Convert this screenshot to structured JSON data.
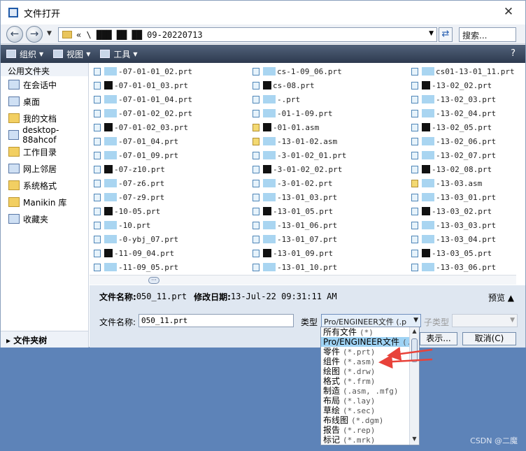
{
  "window": {
    "title": "文件打开",
    "close_glyph": "✕"
  },
  "address": {
    "path": "« \\ ███ ██ ██ 09-20220713",
    "search_placeholder": "搜索..."
  },
  "toolbar": {
    "organize": "组织",
    "view": "视图",
    "tools": "工具",
    "help_glyph": "?"
  },
  "sidebar": {
    "header": "公用文件夹",
    "items": [
      {
        "label": "在会话中",
        "icon": "session-icon"
      },
      {
        "label": "桌面",
        "icon": "desktop-icon"
      },
      {
        "label": "我的文档",
        "icon": "documents-icon"
      },
      {
        "label": "desktop-88ahcof",
        "icon": "computer-icon"
      },
      {
        "label": "工作目录",
        "icon": "work-folder-icon"
      },
      {
        "label": "网上邻居",
        "icon": "network-icon"
      },
      {
        "label": "系统格式",
        "icon": "system-format-icon"
      },
      {
        "label": "Manikin 库",
        "icon": "manikin-icon"
      },
      {
        "label": "收藏夹",
        "icon": "favorites-icon"
      }
    ],
    "folder_tree": "文件夹树"
  },
  "files": {
    "col1": [
      "-07-01-01_02.prt",
      "-07-01-01_03.prt",
      "-07-01-01_04.prt",
      "-07-01-02_02.prt",
      "-07-01-02_03.prt",
      "-07-01_04.prt",
      "-07-01_09.prt",
      "-07-z10.prt",
      "-07-z6.prt",
      "-07-z9.prt",
      "-10-05.prt",
      "-10.prt",
      "-0-ybj_07.prt",
      "-11-09_04.prt",
      "-11-09_05.prt"
    ],
    "col2": [
      "cs-1-09_06.prt",
      "cs-08.prt",
      "-.prt",
      "-01-1-09.prt",
      "-01-01.asm",
      "-13-01-02.asm",
      "-3-01-02_01.prt",
      "-3-01-02_02.prt",
      "-3-01-02.prt",
      "-13-01_03.prt",
      "-13-01_05.prt",
      "-13-01_06.prt",
      "-13-01_07.prt",
      "-13-01_09.prt",
      "-13-01_10.prt"
    ],
    "col3": [
      "cs01-13-01_11.prt",
      "-13-02_02.prt",
      "-13-02_03.prt",
      "-13-02_04.prt",
      "-13-02_05.prt",
      "-13-02_06.prt",
      "-13-02_07.prt",
      "-13-02_08.prt",
      "-13-03.asm",
      "-13-03_01.prt",
      "-13-03_02.prt",
      "-13-03_03.prt",
      "-13-03_04.prt",
      "-13-03_05.prt",
      "-13-03_06.prt"
    ]
  },
  "details": {
    "name_label": "文件名称:",
    "name_value": "050_11.prt",
    "date_label": "修改日期:",
    "date_value": "13-Jul-22 09:31:11 AM",
    "preview": "预览 ▲"
  },
  "form": {
    "filename_label": "文件名称:",
    "filename_value": "050_11.prt",
    "type_label": "类型",
    "type_value": "Pro/ENGINEER文件 (.p",
    "subtype_label": "子类型",
    "open_button": "表示...",
    "cancel_button": "取消(C)"
  },
  "dropdown": {
    "options": [
      {
        "name": "所有文件",
        "pattern": "(*)"
      },
      {
        "name": "Pro/ENGINEER文件",
        "pattern": "(.p"
      },
      {
        "name": "零件",
        "pattern": "(*.prt)"
      },
      {
        "name": "组件",
        "pattern": "(*.asm)"
      },
      {
        "name": "绘图",
        "pattern": "(*.drw)"
      },
      {
        "name": "格式",
        "pattern": "(*.frm)"
      },
      {
        "name": "制造",
        "pattern": "(.asm, .mfg)"
      },
      {
        "name": "布局",
        "pattern": "(*.lay)"
      },
      {
        "name": "草绘",
        "pattern": "(*.sec)"
      },
      {
        "name": "布线图",
        "pattern": "(*.dgm)"
      },
      {
        "name": "报告",
        "pattern": "(*.rep)"
      },
      {
        "name": "标记",
        "pattern": "(*.mrk)"
      }
    ],
    "selected_index": 1
  },
  "colors": {
    "accent": "#9fd3f4",
    "toolbar": "#3a4a62",
    "arrow": "#e8423a",
    "desktop": "#5d83b8"
  },
  "watermark": "CSDN @二魔"
}
